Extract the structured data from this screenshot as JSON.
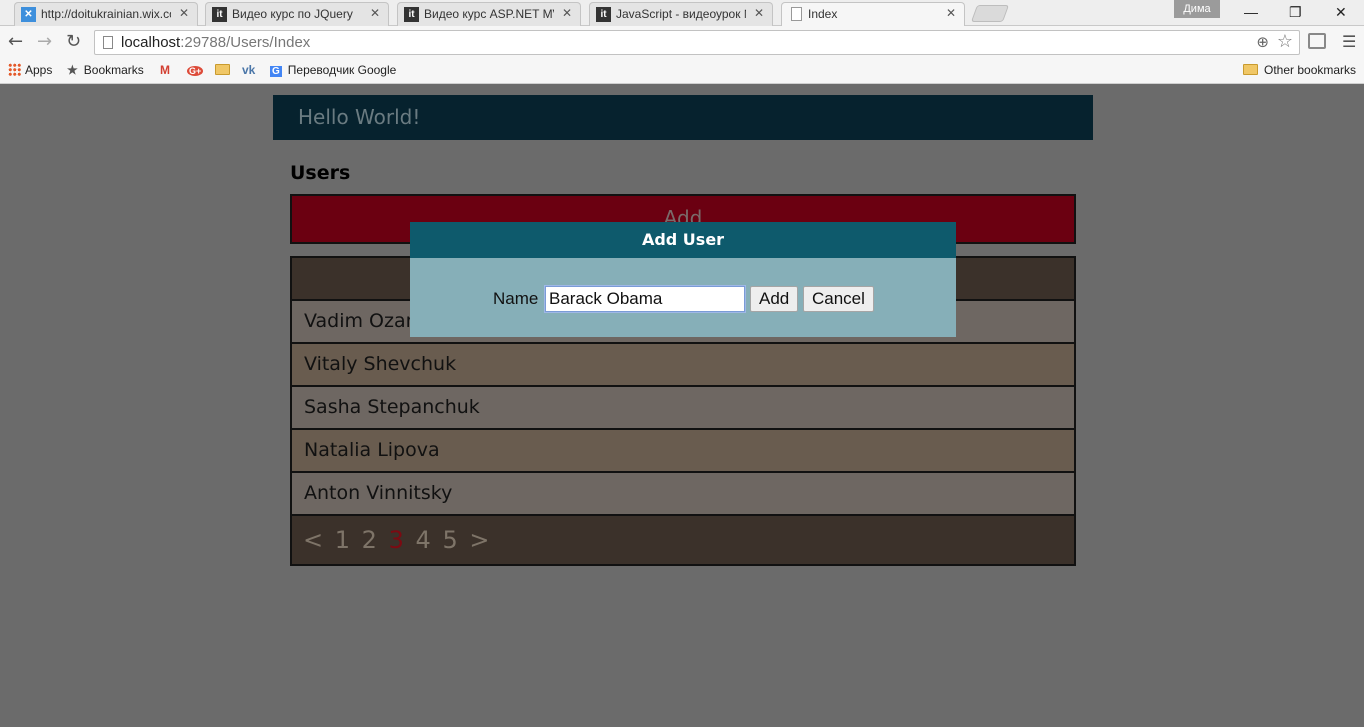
{
  "browser": {
    "tabs": [
      {
        "title": "http://doitukrainian.wix.co",
        "favicon": "wix"
      },
      {
        "title": "Видео курс по JQuery",
        "favicon": "it"
      },
      {
        "title": "Видео курс ASP.NET MVC",
        "favicon": "it"
      },
      {
        "title": "JavaScript - видеоурок №",
        "favicon": "it"
      },
      {
        "title": "Index",
        "favicon": "document"
      }
    ],
    "active_tab": 4,
    "profile_name": "Дима",
    "url_host": "localhost",
    "url_path": ":29788/Users/Index",
    "bookmarks": {
      "apps": "Apps",
      "bookmarks": "Bookmarks",
      "translator": "Переводчик Google",
      "other": "Other bookmarks"
    }
  },
  "site": {
    "title": "Hello World!",
    "heading": "Users",
    "add_label": "Add"
  },
  "users": [
    "Vadim Ozarko",
    "Vitaly Shevchuk",
    "Sasha Stepanchuk",
    "Natalia Lipova",
    "Anton Vinnitsky"
  ],
  "pager": {
    "prev": "<",
    "pages": [
      "1",
      "2",
      "3",
      "4",
      "5"
    ],
    "current": "3",
    "next": ">"
  },
  "modal": {
    "title": "Add User",
    "field_label": "Name",
    "field_value": "Barack Obama",
    "add_button": "Add",
    "cancel_button": "Cancel"
  },
  "colors": {
    "header_bg": "#06222e",
    "add_bar_bg": "#6b0011",
    "modal_header_bg": "#0e5a6c",
    "modal_body_bg": "#86afb8",
    "pager_current": "#7c0a12"
  }
}
